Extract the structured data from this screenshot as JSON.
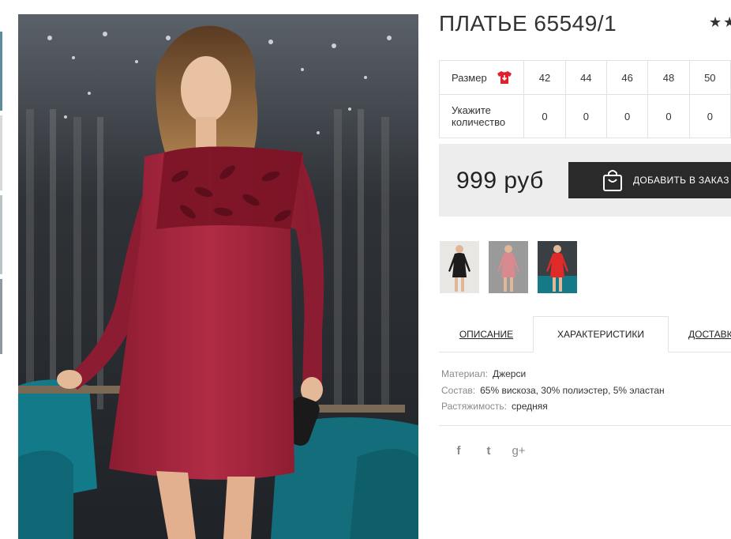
{
  "product": {
    "title": "ПЛАТЬЕ 65549/1",
    "rating_stars": "★★"
  },
  "sizes": {
    "size_label": "Размер",
    "qty_label": "Укажите количество",
    "values": [
      "42",
      "44",
      "46",
      "48",
      "50"
    ],
    "quantities": [
      "0",
      "0",
      "0",
      "0",
      "0"
    ]
  },
  "purchase": {
    "price": "999 руб",
    "add_button_label": "ДОБАВИТЬ В ЗАКАЗ"
  },
  "variants": [
    {
      "color": "#1c1c1c"
    },
    {
      "color": "#d98a8f"
    },
    {
      "color": "#e02a2a"
    }
  ],
  "tabs": {
    "description": "ОПИСАНИЕ",
    "characteristics": "ХАРАКТЕРИСТИКИ",
    "delivery": "ДОСТАВКА"
  },
  "specs": [
    {
      "key": "Материал:",
      "value": "Джерси"
    },
    {
      "key": "Состав:",
      "value": "65% вискоза, 30% полиэстер, 5% эластан"
    },
    {
      "key": "Растяжимость:",
      "value": "средняя"
    }
  ],
  "social": {
    "facebook": "f",
    "twitter": "t",
    "googleplus": "g+"
  },
  "colors": {
    "dress": "#a3253c",
    "button_bg": "#2a2a2a",
    "price_box_bg": "#ededed",
    "icon_red": "#e0212b"
  }
}
